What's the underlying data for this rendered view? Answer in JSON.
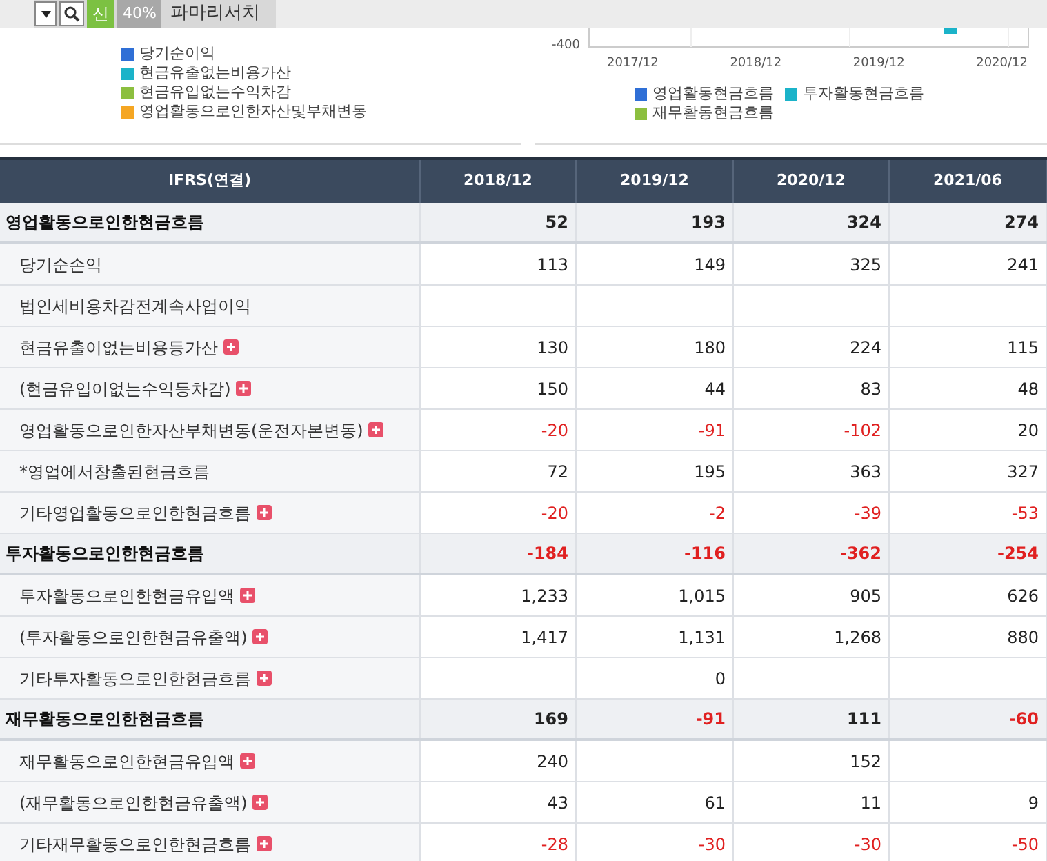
{
  "toolbar": {
    "badge": "신",
    "percent": "40%",
    "title": "파마리서치"
  },
  "left_chart": {
    "legend": [
      {
        "label": "당기순이익",
        "color": "#2f6fd6"
      },
      {
        "label": "현금유출없는비용가산",
        "color": "#1bb3c9"
      },
      {
        "label": "현금유입없는수익차감",
        "color": "#8cbf3f"
      },
      {
        "label": "영업활동으로인한자산및부채변동",
        "color": "#f5a623"
      }
    ]
  },
  "right_chart": {
    "y_tick": "-400",
    "x_ticks": [
      "2017/12",
      "2018/12",
      "2019/12",
      "2020/12"
    ],
    "legend": [
      {
        "label": "영업활동현금흐름",
        "color": "#2f6fd6"
      },
      {
        "label": "투자활동현금흐름",
        "color": "#1bb3c9"
      },
      {
        "label": "재무활동현금흐름",
        "color": "#8cbf3f"
      }
    ]
  },
  "table": {
    "columns": [
      "IFRS(연결)",
      "2018/12",
      "2019/12",
      "2020/12",
      "2021/06"
    ],
    "rows": [
      {
        "kind": "section",
        "label": "영업활동으로인한현금흐름",
        "expandable": false,
        "values": {
          "col_2": {
            "text": "52",
            "negative": false
          },
          "col_3": {
            "text": "193",
            "negative": false
          },
          "col_4": {
            "text": "324",
            "negative": false
          },
          "col_5": {
            "text": "274",
            "negative": false
          }
        }
      },
      {
        "kind": "item",
        "label": "당기순손익",
        "expandable": false,
        "values": {
          "col_2": {
            "text": "113",
            "negative": false
          },
          "col_3": {
            "text": "149",
            "negative": false
          },
          "col_4": {
            "text": "325",
            "negative": false
          },
          "col_5": {
            "text": "241",
            "negative": false
          }
        }
      },
      {
        "kind": "item",
        "label": "법인세비용차감전계속사업이익",
        "expandable": false
      },
      {
        "kind": "item",
        "label": "현금유출이없는비용등가산",
        "expandable": true,
        "values": {
          "col_2": {
            "text": "130",
            "negative": false
          },
          "col_3": {
            "text": "180",
            "negative": false
          },
          "col_4": {
            "text": "224",
            "negative": false
          },
          "col_5": {
            "text": "115",
            "negative": false
          }
        }
      },
      {
        "kind": "item",
        "label": "(현금유입이없는수익등차감)",
        "expandable": true,
        "values": {
          "col_2": {
            "text": "150",
            "negative": false
          },
          "col_3": {
            "text": "44",
            "negative": false
          },
          "col_4": {
            "text": "83",
            "negative": false
          },
          "col_5": {
            "text": "48",
            "negative": false
          }
        }
      },
      {
        "kind": "item",
        "label": "영업활동으로인한자산부채변동(운전자본변동)",
        "expandable": true,
        "values": {
          "col_2": {
            "text": "-20",
            "negative": true
          },
          "col_3": {
            "text": "-91",
            "negative": true
          },
          "col_4": {
            "text": "-102",
            "negative": true
          },
          "col_5": {
            "text": "20",
            "negative": false
          }
        }
      },
      {
        "kind": "item",
        "label": "*영업에서창출된현금흐름",
        "expandable": false,
        "values": {
          "col_2": {
            "text": "72",
            "negative": false
          },
          "col_3": {
            "text": "195",
            "negative": false
          },
          "col_4": {
            "text": "363",
            "negative": false
          },
          "col_5": {
            "text": "327",
            "negative": false
          }
        }
      },
      {
        "kind": "item",
        "label": "기타영업활동으로인한현금흐름",
        "expandable": true,
        "values": {
          "col_2": {
            "text": "-20",
            "negative": true
          },
          "col_3": {
            "text": "-2",
            "negative": true
          },
          "col_4": {
            "text": "-39",
            "negative": true
          },
          "col_5": {
            "text": "-53",
            "negative": true
          }
        }
      },
      {
        "kind": "section",
        "label": "투자활동으로인한현금흐름",
        "expandable": false,
        "values": {
          "col_2": {
            "text": "-184",
            "negative": true
          },
          "col_3": {
            "text": "-116",
            "negative": true
          },
          "col_4": {
            "text": "-362",
            "negative": true
          },
          "col_5": {
            "text": "-254",
            "negative": true
          }
        }
      },
      {
        "kind": "item",
        "label": "투자활동으로인한현금유입액",
        "expandable": true,
        "values": {
          "col_2": {
            "text": "1,233",
            "negative": false
          },
          "col_3": {
            "text": "1,015",
            "negative": false
          },
          "col_4": {
            "text": "905",
            "negative": false
          },
          "col_5": {
            "text": "626",
            "negative": false
          }
        }
      },
      {
        "kind": "item",
        "label": "(투자활동으로인한현금유출액)",
        "expandable": true,
        "values": {
          "col_2": {
            "text": "1,417",
            "negative": false
          },
          "col_3": {
            "text": "1,131",
            "negative": false
          },
          "col_4": {
            "text": "1,268",
            "negative": false
          },
          "col_5": {
            "text": "880",
            "negative": false
          }
        }
      },
      {
        "kind": "item",
        "label": "기타투자활동으로인한현금흐름",
        "expandable": true,
        "values": {
          "col_3": {
            "text": "0",
            "negative": false
          }
        }
      },
      {
        "kind": "section",
        "label": "재무활동으로인한현금흐름",
        "expandable": false,
        "values": {
          "col_2": {
            "text": "169",
            "negative": false
          },
          "col_3": {
            "text": "-91",
            "negative": true
          },
          "col_4": {
            "text": "111",
            "negative": false
          },
          "col_5": {
            "text": "-60",
            "negative": true
          }
        }
      },
      {
        "kind": "item",
        "label": "재무활동으로인한현금유입액",
        "expandable": true,
        "values": {
          "col_2": {
            "text": "240",
            "negative": false
          },
          "col_4": {
            "text": "152",
            "negative": false
          }
        }
      },
      {
        "kind": "item",
        "label": "(재무활동으로인한현금유출액)",
        "expandable": true,
        "values": {
          "col_2": {
            "text": "43",
            "negative": false
          },
          "col_3": {
            "text": "61",
            "negative": false
          },
          "col_4": {
            "text": "11",
            "negative": false
          },
          "col_5": {
            "text": "9",
            "negative": false
          }
        }
      },
      {
        "kind": "item",
        "label": "기타재무활동으로인한현금흐름",
        "expandable": true,
        "values": {
          "col_2": {
            "text": "-28",
            "negative": true
          },
          "col_3": {
            "text": "-30",
            "negative": true
          },
          "col_4": {
            "text": "-30",
            "negative": true
          },
          "col_5": {
            "text": "-50",
            "negative": true
          }
        }
      }
    ]
  }
}
